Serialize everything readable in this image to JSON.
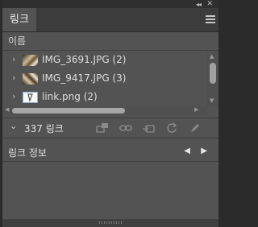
{
  "window": {
    "collapse_glyph": "◂◂",
    "close_glyph": "✕"
  },
  "tab": {
    "label": "링크"
  },
  "list": {
    "column_header": "이름",
    "rows": [
      {
        "name": "IMG_3691.JPG (2)",
        "icon": "photo-thumbnail"
      },
      {
        "name": "IMG_9417.JPG (3)",
        "icon": "photo-thumbnail"
      },
      {
        "name": "link.png (2)",
        "icon": "png-file-thumbnail"
      }
    ]
  },
  "toolbar": {
    "chevron": "⌄",
    "count_label": "337 링크",
    "tools": [
      "relink-from-cc-library-icon",
      "relink-icon",
      "go-to-link-icon",
      "update-link-icon",
      "edit-original-icon"
    ]
  },
  "link_info": {
    "label": "링크 정보",
    "prev_glyph": "◀",
    "next_glyph": "▶"
  },
  "colors": {
    "panel": "#535353",
    "tab_bar": "#3c3c3c",
    "frame": "#2b2b2b",
    "text": "#d9d9d9"
  }
}
